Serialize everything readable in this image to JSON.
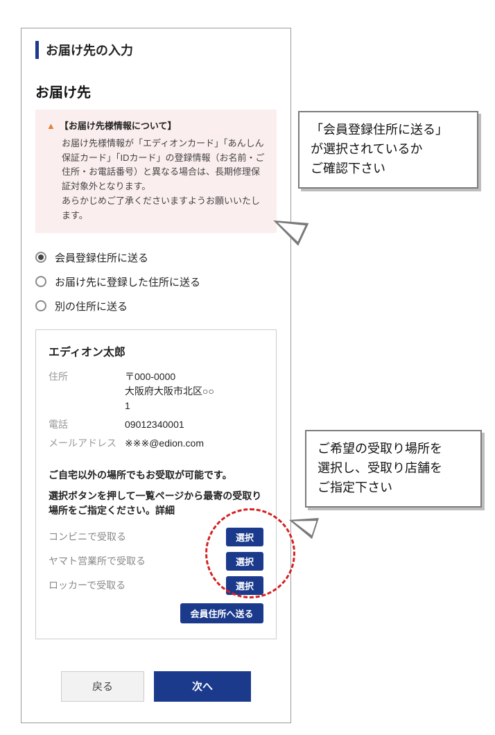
{
  "header": {
    "title": "お届け先の入力"
  },
  "section": {
    "title": "お届け先",
    "notice": {
      "heading": "【お届け先様情報について】",
      "body": "お届け先様情報が「エディオンカード」「あんしん保証カード」「IDカード」の登録情報（お名前・ご住所・お電話番号）と異なる場合は、長期修理保証対象外となります。\nあらかじめご了承くださいますようお願いいたします。"
    },
    "radios": [
      {
        "label": "会員登録住所に送る",
        "selected": true
      },
      {
        "label": "お届け先に登録した住所に送る",
        "selected": false
      },
      {
        "label": "別の住所に送る",
        "selected": false
      }
    ],
    "address": {
      "name": "エディオン太郎",
      "rows": [
        {
          "label": "住所",
          "value": "〒000-0000\n大阪府大阪市北区○○\n1"
        },
        {
          "label": "電話",
          "value": "09012340001"
        },
        {
          "label": "メールアドレス",
          "value": "※※※@edion.com"
        }
      ],
      "pickup_heading": "ご自宅以外の場所でもお受取が可能です。",
      "pickup_instruction": "選択ボタンを押して一覧ページから最寄の受取り場所をご指定ください。詳細",
      "options": [
        {
          "label": "コンビニで受取る",
          "btn": "選択"
        },
        {
          "label": "ヤマト営業所で受取る",
          "btn": "選択"
        },
        {
          "label": "ロッカーで受取る",
          "btn": "選択"
        }
      ],
      "member_send_btn": "会員住所へ送る"
    }
  },
  "footer": {
    "back": "戻る",
    "next": "次へ"
  },
  "callouts": {
    "c1": "「会員登録住所に送る」\nが選択されているか\nご確認下さい",
    "c2": "ご希望の受取り場所を\n選択し、受取り店舗を\nご指定下さい"
  }
}
